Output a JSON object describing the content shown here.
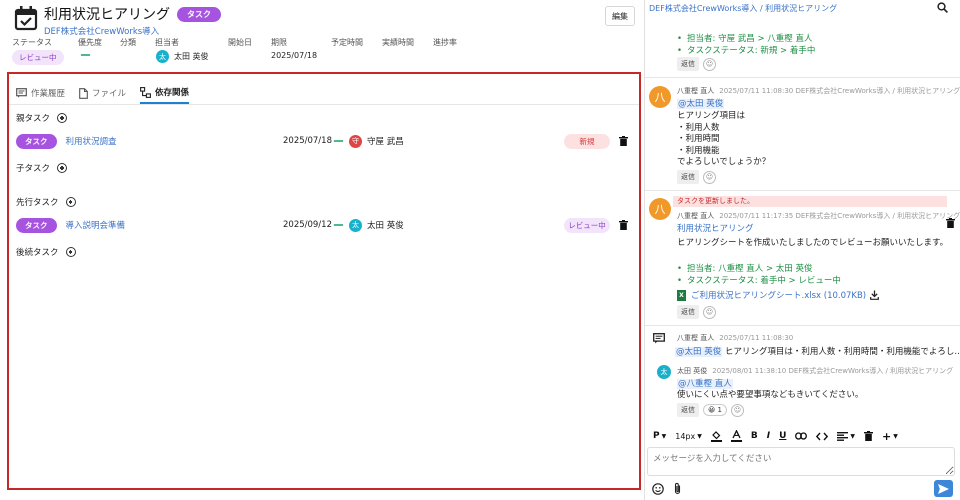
{
  "header": {
    "title": "利用状況ヒアリング",
    "type_badge": "タスク",
    "project_link": "DEF株式会社CrewWorks導入",
    "edit_label": "編集"
  },
  "meta": {
    "labels": [
      "ステータス",
      "優先度",
      "分類",
      "担当者",
      "開始日",
      "期限",
      "予定時間",
      "実績時間",
      "進捗率"
    ],
    "status": "レビュー中",
    "priority": "ー",
    "assignee": "太田 英俊",
    "assignee_initial": "太",
    "due": "2025/07/18"
  },
  "tabs": [
    {
      "label": "作業履歴",
      "icon": "comment-icon"
    },
    {
      "label": "ファイル",
      "icon": "file-icon"
    },
    {
      "label": "依存関係",
      "icon": "dependency-icon",
      "active": true
    }
  ],
  "sections": {
    "parent": "親タスク",
    "child": "子タスク",
    "predecessor": "先行タスク",
    "successor": "後続タスク"
  },
  "parent_task": {
    "badge": "タスク",
    "name": "利用状況調査",
    "date": "2025/07/18",
    "dash": "ー",
    "user": "守屋 武昌",
    "user_initial": "守",
    "status": "新規"
  },
  "predecessor_task": {
    "badge": "タスク",
    "name": "導入説明会準備",
    "date": "2025/09/12",
    "dash": "ー",
    "user": "太田 英俊",
    "user_initial": "太",
    "status": "レビュー中"
  },
  "chat": {
    "breadcrumb": "DEF株式会社CrewWorks導入 / 利用状況ヒアリング",
    "reply": "返信",
    "top": {
      "lines": [
        "担当者: 守屋 武昌 > 八重樫 直人",
        "タスクステータス: 新規 > 着手中"
      ]
    },
    "msg1": {
      "initial": "八",
      "author": "八重樫 直人",
      "meta": "2025/07/11 11:08:30   DEF株式会社CrewWorks導入 / 利用状況ヒアリング",
      "mention": "@太田 英俊",
      "lines": [
        "ヒアリング項目は",
        "・利用人数",
        "・利用時間",
        "・利用機能",
        "でよろしいでしょうか？"
      ]
    },
    "msg2": {
      "banner": "タスクを更新しました。",
      "initial": "八",
      "author": "八重樫 直人",
      "meta": "2025/07/11 11:17:35   DEF株式会社CrewWorks導入 / 利用状況ヒアリング",
      "task_link": "利用状況ヒアリング",
      "text": "ヒアリングシートを作成いたしましたのでレビューお願いいたします。",
      "lines": [
        "担当者: 八重樫 直人 > 太田 英俊",
        "タスクステータス: 着手中 > レビュー中"
      ],
      "file": "ご利用状況ヒアリングシート.xlsx (10.07KB)"
    },
    "msg3": {
      "author": "八重樫 直人",
      "meta": "2025/07/11 11:08:30",
      "mention": "@太田 英俊",
      "text": "ヒアリング項目は・利用人数・利用時間・利用機能でよろし..."
    },
    "msg4": {
      "initial": "太",
      "author": "太田 英俊",
      "meta": "2025/08/01 11:38:10   DEF株式会社CrewWorks導入 / 利用状況ヒアリング",
      "mention": "@八重樫 直人",
      "text": "使いにくい点や要望事項などもきいてください。",
      "reaction": "😀 1"
    },
    "toolbar": {
      "paragraph": "P",
      "font_size": "14px",
      "bold": "B",
      "italic": "I",
      "underline": "U",
      "plus": "+"
    },
    "input_placeholder": "メッセージを入力してください"
  },
  "colors": {
    "accent": "#a654e0",
    "link": "#3a72c8",
    "highlight_border": "#c62828",
    "green": "#1f8f45",
    "send": "#3d87d8"
  }
}
